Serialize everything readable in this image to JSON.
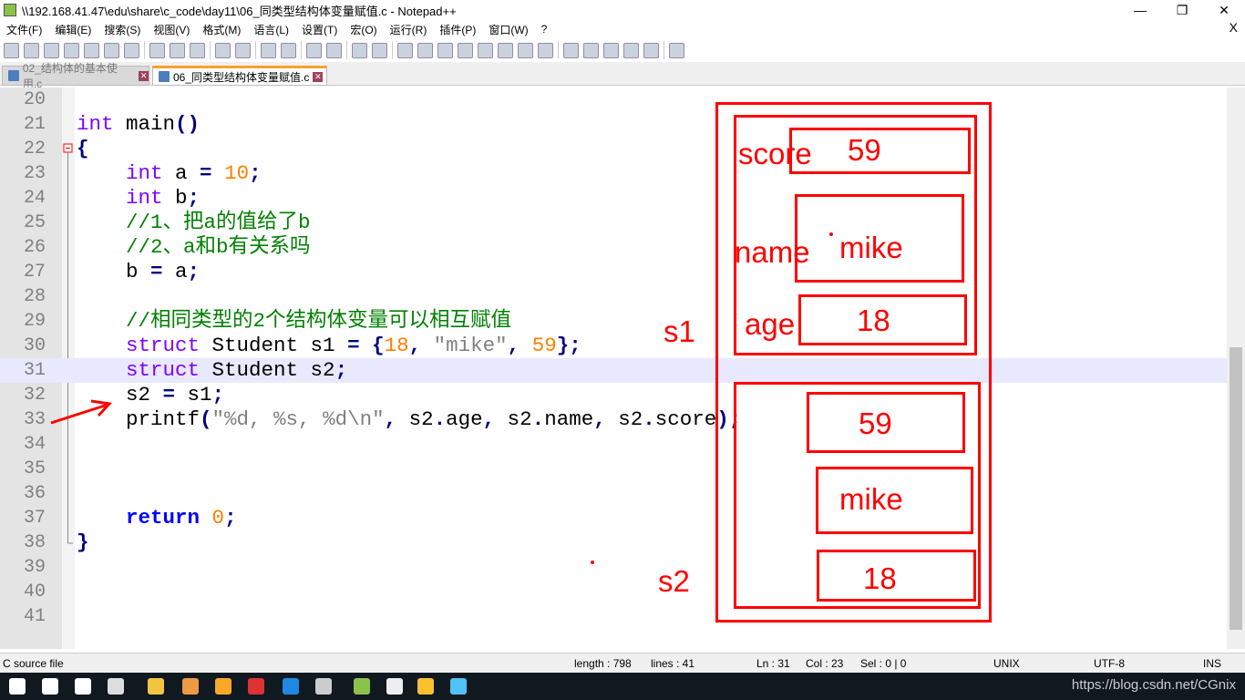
{
  "window": {
    "title": "\\\\192.168.41.47\\edu\\share\\c_code\\day11\\06_同类型结构体变量赋值.c - Notepad++",
    "minimize": "—",
    "maximize": "❐",
    "close": "✕"
  },
  "menu": [
    "文件(F)",
    "编辑(E)",
    "搜索(S)",
    "视图(V)",
    "格式(M)",
    "语言(L)",
    "设置(T)",
    "宏(O)",
    "运行(R)",
    "插件(P)",
    "窗口(W)",
    "?"
  ],
  "menu_close": "X",
  "tabs": [
    {
      "label": "02_结构体的基本使用.c",
      "active": false
    },
    {
      "label": "06_同类型结构体变量赋值.c",
      "active": true
    }
  ],
  "code_lines": [
    {
      "n": "20",
      "t": []
    },
    {
      "n": "21",
      "t": [
        [
          "kw",
          "int"
        ],
        [
          "tx",
          " main"
        ],
        [
          "op",
          "()"
        ]
      ]
    },
    {
      "n": "22",
      "t": [
        [
          "op",
          "{"
        ]
      ]
    },
    {
      "n": "23",
      "t": [
        [
          "tx",
          "    "
        ],
        [
          "kw",
          "int"
        ],
        [
          "tx",
          " a "
        ],
        [
          "op",
          "="
        ],
        [
          "tx",
          " "
        ],
        [
          "num",
          "10"
        ],
        [
          "op",
          ";"
        ]
      ]
    },
    {
      "n": "24",
      "t": [
        [
          "tx",
          "    "
        ],
        [
          "kw",
          "int"
        ],
        [
          "tx",
          " b"
        ],
        [
          "op",
          ";"
        ]
      ]
    },
    {
      "n": "25",
      "t": [
        [
          "cm",
          "    //1、把a的值给了b"
        ]
      ]
    },
    {
      "n": "26",
      "t": [
        [
          "cm",
          "    //2、a和b有关系吗"
        ]
      ]
    },
    {
      "n": "27",
      "t": [
        [
          "tx",
          "    b "
        ],
        [
          "op",
          "="
        ],
        [
          "tx",
          " a"
        ],
        [
          "op",
          ";"
        ]
      ]
    },
    {
      "n": "28",
      "t": []
    },
    {
      "n": "29",
      "t": [
        [
          "cm",
          "    //相同类型的2个结构体变量可以相互赋值"
        ]
      ]
    },
    {
      "n": "30",
      "t": [
        [
          "tx",
          "    "
        ],
        [
          "kw",
          "struct"
        ],
        [
          "tx",
          " Student s1 "
        ],
        [
          "op",
          "="
        ],
        [
          "tx",
          " "
        ],
        [
          "op",
          "{"
        ],
        [
          "num",
          "18"
        ],
        [
          "op",
          ","
        ],
        [
          "tx",
          " "
        ],
        [
          "str",
          "\"mike\""
        ],
        [
          "op",
          ","
        ],
        [
          "tx",
          " "
        ],
        [
          "num",
          "59"
        ],
        [
          "op",
          "};"
        ]
      ]
    },
    {
      "n": "31",
      "t": [
        [
          "tx",
          "    "
        ],
        [
          "kw",
          "struct"
        ],
        [
          "tx",
          " Student s2"
        ],
        [
          "op",
          ";"
        ]
      ],
      "current": true
    },
    {
      "n": "32",
      "t": [
        [
          "tx",
          "    s2 "
        ],
        [
          "op",
          "="
        ],
        [
          "tx",
          " s1"
        ],
        [
          "op",
          ";"
        ]
      ]
    },
    {
      "n": "33",
      "t": [
        [
          "tx",
          "    printf"
        ],
        [
          "op",
          "("
        ],
        [
          "str",
          "\"%d, %s, %d\\n\""
        ],
        [
          "op",
          ","
        ],
        [
          "tx",
          " s2"
        ],
        [
          "op",
          "."
        ],
        [
          "tx",
          "age"
        ],
        [
          "op",
          ","
        ],
        [
          "tx",
          " s2"
        ],
        [
          "op",
          "."
        ],
        [
          "tx",
          "name"
        ],
        [
          "op",
          ","
        ],
        [
          "tx",
          " s2"
        ],
        [
          "op",
          "."
        ],
        [
          "tx",
          "score"
        ],
        [
          "op",
          ");"
        ]
      ]
    },
    {
      "n": "34",
      "t": []
    },
    {
      "n": "35",
      "t": []
    },
    {
      "n": "36",
      "t": []
    },
    {
      "n": "37",
      "t": [
        [
          "tx",
          "    "
        ],
        [
          "kwb",
          "return"
        ],
        [
          "tx",
          " "
        ],
        [
          "num",
          "0"
        ],
        [
          "op",
          ";"
        ]
      ]
    },
    {
      "n": "38",
      "t": [
        [
          "op",
          "}"
        ]
      ]
    },
    {
      "n": "39",
      "t": []
    },
    {
      "n": "40",
      "t": []
    },
    {
      "n": "41",
      "t": []
    }
  ],
  "annotations": {
    "color": "#ff0000",
    "s1": "s1",
    "s2": "s2",
    "score_label": "score",
    "name_label": "name",
    "age_label": "age",
    "s1_score": "59",
    "s1_name": "mike",
    "s1_age": "18",
    "s2_score": "59",
    "s2_name": "mike",
    "s2_age": "18"
  },
  "status": {
    "file_type": "C source file",
    "length": "length : 798",
    "lines": "lines : 41",
    "ln": "Ln : 31",
    "col": "Col : 23",
    "sel": "Sel : 0 | 0",
    "eol": "UNIX",
    "encoding": "UTF-8",
    "mode": "INS"
  },
  "taskbar": {
    "watermark": "https://blog.csdn.net/CGnix"
  }
}
